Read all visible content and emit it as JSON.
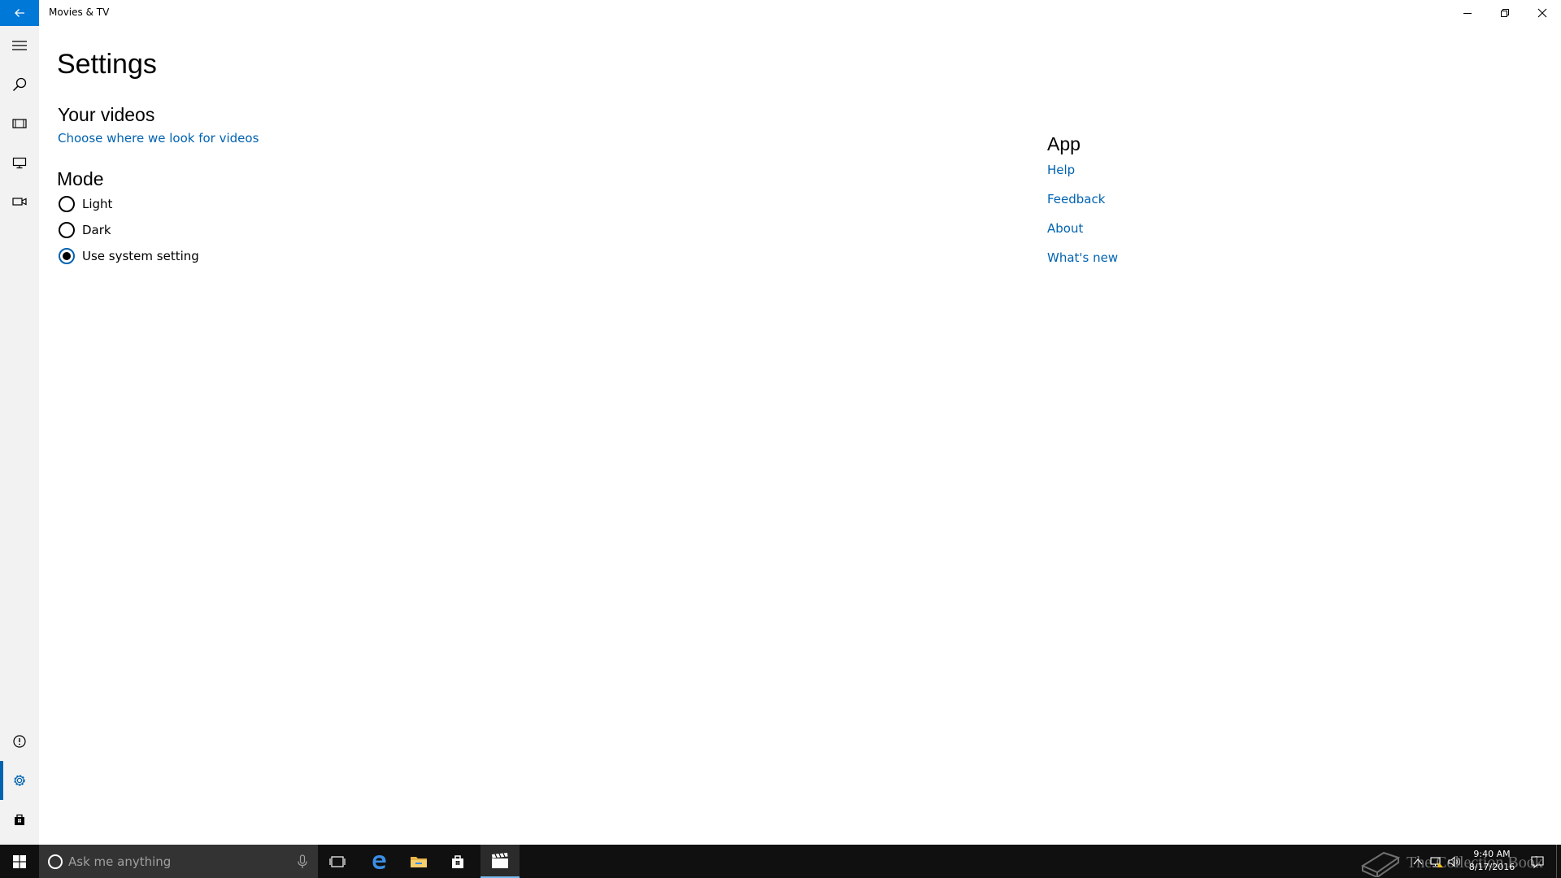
{
  "window": {
    "title": "Movies & TV",
    "accent": "#0078d7"
  },
  "nav": {
    "items": [
      {
        "id": "hamburger",
        "icon": "hamburger-menu-icon"
      },
      {
        "id": "search",
        "icon": "search-icon"
      },
      {
        "id": "movies",
        "icon": "film-icon"
      },
      {
        "id": "tv",
        "icon": "monitor-icon"
      },
      {
        "id": "personal",
        "icon": "video-camera-icon"
      },
      {
        "id": "feedback",
        "icon": "info-icon"
      },
      {
        "id": "settings",
        "icon": "gear-icon",
        "selected": true
      },
      {
        "id": "store",
        "icon": "store-bag-icon"
      }
    ]
  },
  "settings": {
    "title": "Settings",
    "videos": {
      "heading": "Your videos",
      "link": "Choose where we look for videos"
    },
    "mode": {
      "heading": "Mode",
      "options": [
        {
          "label": "Light",
          "selected": false
        },
        {
          "label": "Dark",
          "selected": false
        },
        {
          "label": "Use system setting",
          "selected": true
        }
      ]
    },
    "app": {
      "heading": "App",
      "links": [
        "Help",
        "Feedback",
        "About",
        "What's new"
      ]
    },
    "link_color": "#0063b1"
  },
  "taskbar": {
    "search_placeholder": "Ask me anything",
    "clock_time": "9:40 AM",
    "clock_date": "8/17/2016",
    "watermark": "The Collection Book",
    "active_indicator": "#76b9ed"
  }
}
